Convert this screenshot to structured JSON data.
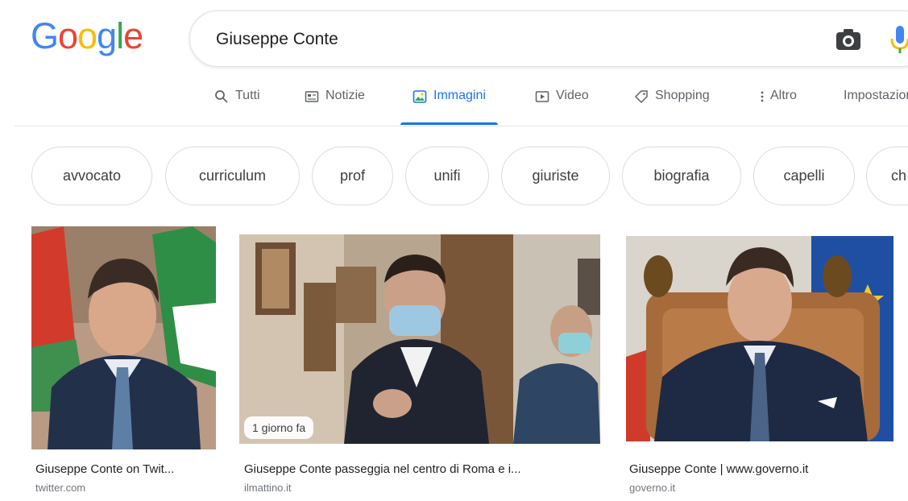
{
  "search": {
    "query": "Giuseppe Conte"
  },
  "logo": {
    "letters": [
      "G",
      "o",
      "o",
      "g",
      "l",
      "e"
    ],
    "colors": [
      "#4285f4",
      "#ea4335",
      "#fbbc05",
      "#4285f4",
      "#34a853",
      "#ea4335"
    ]
  },
  "tabs": [
    {
      "label": "Tutti",
      "icon": "search-icon"
    },
    {
      "label": "Notizie",
      "icon": "news-icon"
    },
    {
      "label": "Immagini",
      "icon": "images-icon",
      "active": true
    },
    {
      "label": "Video",
      "icon": "video-icon"
    },
    {
      "label": "Shopping",
      "icon": "tag-icon"
    },
    {
      "label": "Altro",
      "icon": "more-vert-icon"
    },
    {
      "label": "Impostazioni",
      "icon": ""
    }
  ],
  "chips": [
    "avvocato",
    "curriculum",
    "prof",
    "unifi",
    "giuriste",
    "biografia",
    "capelli",
    "ch"
  ],
  "results": [
    {
      "title": "Giuseppe Conte on Twit...",
      "source": "twitter.com",
      "badge": ""
    },
    {
      "title": "Giuseppe Conte passeggia nel centro di Roma e i...",
      "source": "ilmattino.it",
      "badge": "1 giorno fa"
    },
    {
      "title": "Giuseppe Conte | www.governo.it",
      "source": "governo.it",
      "badge": ""
    }
  ],
  "colors": {
    "accent": "#1a73e8",
    "text": "#202124",
    "muted": "#5f6368"
  }
}
